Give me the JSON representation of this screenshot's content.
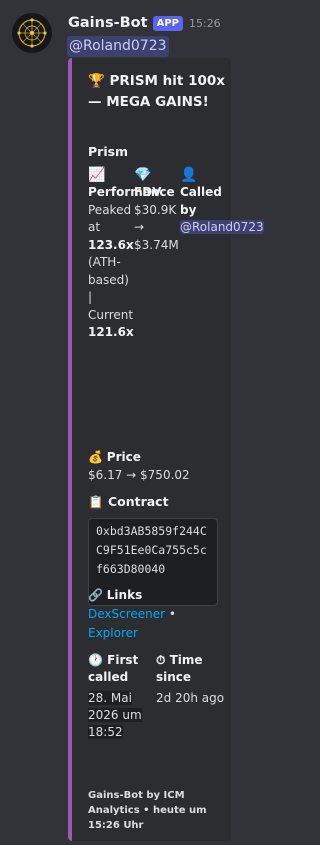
{
  "message": {
    "author": "Gains-Bot",
    "badge": "APP",
    "time": "15:26",
    "mention": "@Roland0723"
  },
  "embed": {
    "title_emoji": "🏆",
    "title": "PRISM hit 100x — MEGA GAINS!",
    "description": "Prism",
    "fields": [
      {
        "emoji": "📈",
        "name": "Performance",
        "peaked_text": "Peaked at",
        "peaked_value": "123.6x",
        "note": "(ATH-based) | Current",
        "current_value": "121.6x"
      },
      {
        "emoji": "💎",
        "name": "FDV",
        "value": "$30.9K → $3.74M"
      },
      {
        "emoji": "👤",
        "name": "Called by",
        "value": "@Roland0723"
      }
    ],
    "price": {
      "emoji": "💰",
      "name": "Price",
      "value": "$6.17 → $750.02"
    },
    "contract": {
      "emoji": "📋",
      "name": "Contract",
      "address": "0xbd3AB5859f244CC9F51Ee0Ca755c5cf663D80040"
    },
    "links": {
      "emoji": "🔗",
      "name": "Links",
      "link1": "DexScreener",
      "separator": " • ",
      "link2": "Explorer"
    },
    "first_called": {
      "emoji": "🕐",
      "name": "First called",
      "value": "28. Mai 2026 um 18:52"
    },
    "time_since": {
      "emoji": "⏱",
      "name": "Time since",
      "value": "2d 20h ago"
    },
    "footer": "Gains-Bot by ICM Analytics • heute um 15:26 Uhr"
  },
  "colors": {
    "accent_bar": "#9b59b6",
    "badge": "#5865f2",
    "mention_bg": "#3c4270",
    "link": "#00a8fc"
  }
}
